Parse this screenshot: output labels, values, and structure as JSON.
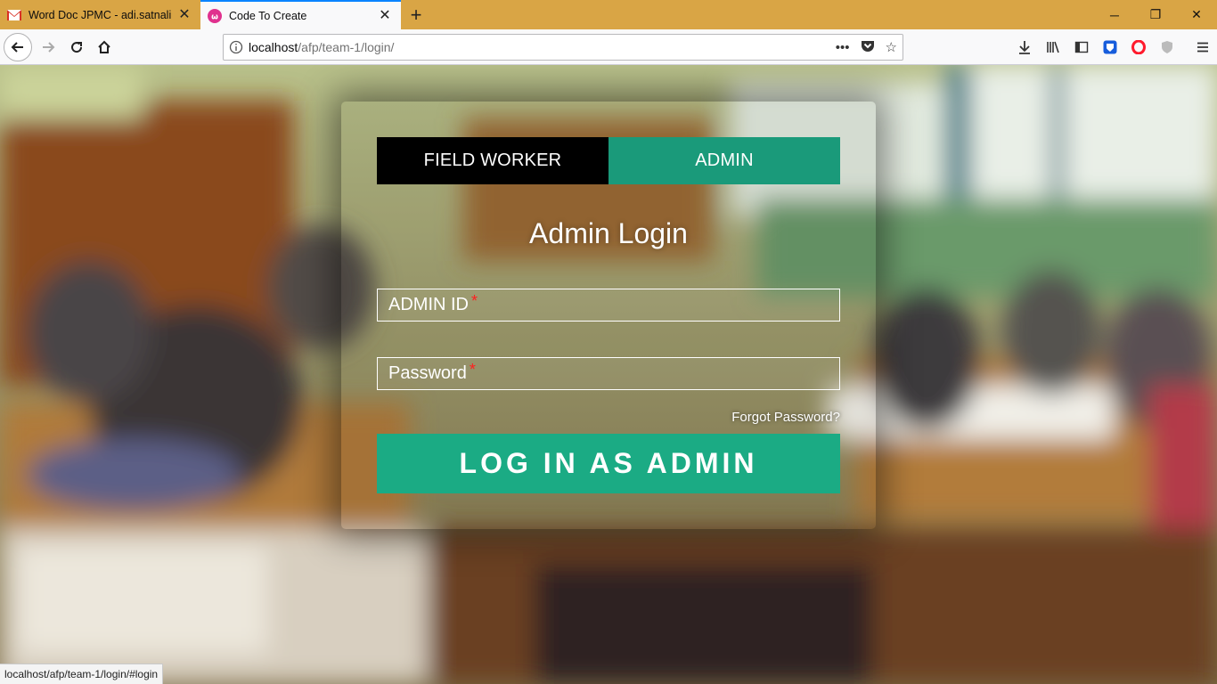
{
  "browser": {
    "tabs": [
      {
        "title": "Word Doc JPMC - adi.satnalika",
        "icon": "gmail-icon",
        "active": false
      },
      {
        "title": "Code To Create",
        "icon": "code-to-create-icon",
        "active": true
      }
    ],
    "url_host": "localhost",
    "url_path": "/afp/team-1/login/",
    "status_url": "localhost/afp/team-1/login/#login"
  },
  "login": {
    "tab_worker": "FIELD WORKER",
    "tab_admin": "ADMIN",
    "heading": "Admin Login",
    "admin_id_placeholder": "ADMIN ID",
    "password_placeholder": "Password",
    "required_mark": "*",
    "forgot_password": "Forgot Password?",
    "submit_label": "LOG IN AS ADMIN"
  },
  "colors": {
    "tabbar": "#d9a545",
    "admin_tab": "#1a9a7a",
    "login_button": "#1bab84",
    "required": "#ff2020"
  }
}
